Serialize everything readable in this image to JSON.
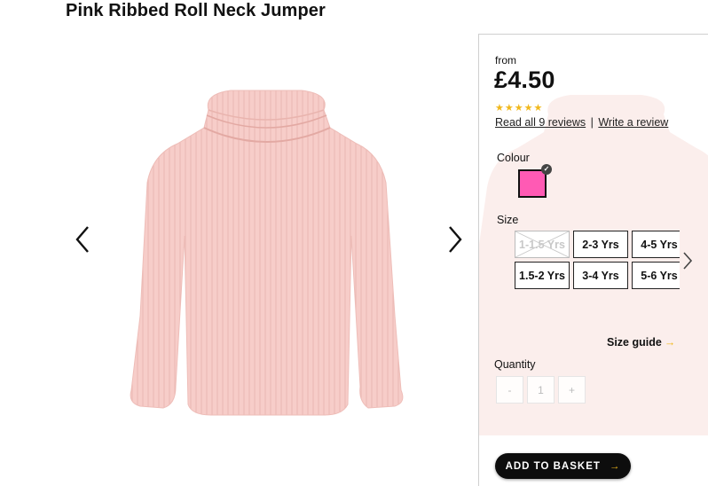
{
  "product": {
    "title": "Pink Ribbed Roll Neck Jumper"
  },
  "gallery": {
    "prev_icon": "chevron-left-icon",
    "next_icon": "chevron-right-icon",
    "image_color": "#f7cdc9"
  },
  "pricing": {
    "from_label": "from",
    "price": "£4.50"
  },
  "rating": {
    "stars": "★★★★★",
    "star_color": "#f1b81c",
    "reviews_link": "Read all 9 reviews",
    "separator": "|",
    "write_link": "Write a review"
  },
  "colour": {
    "label": "Colour",
    "selected_color": "#ff5ab4",
    "check": "✓"
  },
  "size": {
    "label": "Size",
    "rows": [
      [
        "1-1.5 Yrs",
        "2-3 Yrs",
        "4-5 Yrs"
      ],
      [
        "1.5-2 Yrs",
        "3-4 Yrs",
        "5-6 Yrs"
      ]
    ],
    "unavailable": [
      "1-1.5 Yrs"
    ],
    "next_icon": "chevron-right-icon",
    "guide_label": "Size guide",
    "guide_arrow": "→"
  },
  "quantity": {
    "label": "Quantity",
    "minus": "-",
    "value": "1",
    "plus": "+"
  },
  "basket": {
    "label": "ADD TO BASKET",
    "arrow": "→"
  }
}
